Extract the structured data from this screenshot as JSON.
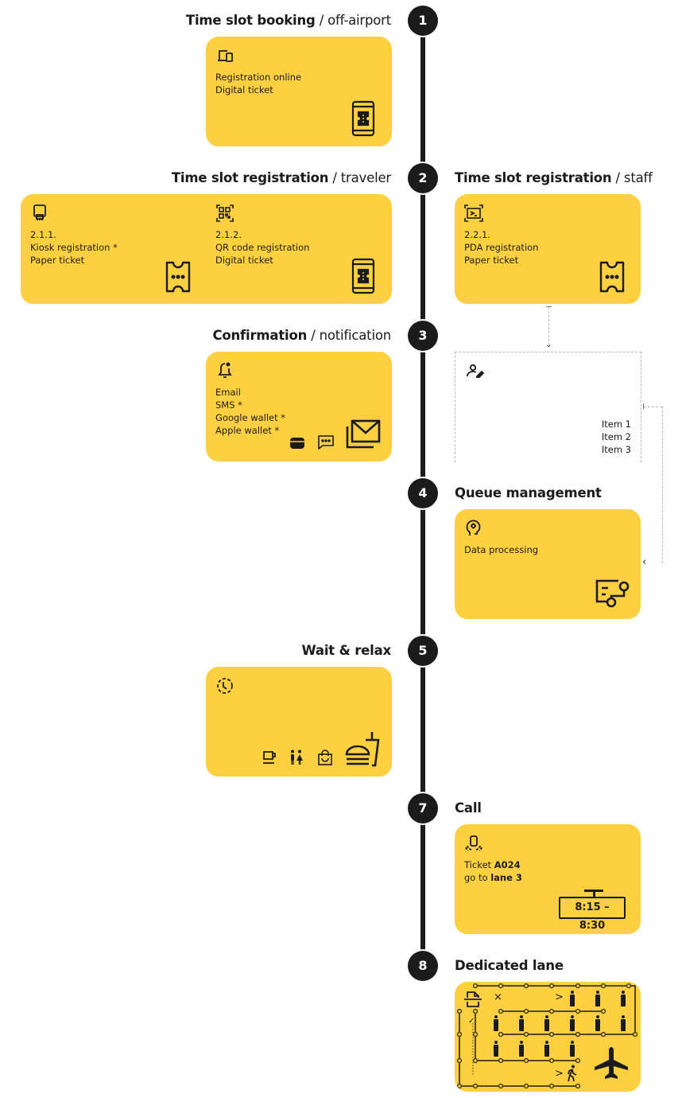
{
  "colors": {
    "card": "#fdd042",
    "ink": "#1b1b1b",
    "rail": "#1b1b1b",
    "dashed": "#b8b8b8"
  },
  "steps": [
    {
      "number": "1",
      "title": "Time slot booking",
      "subtitle": " / off-airport",
      "card": {
        "lines": [
          "Registration online",
          "Digital ticket"
        ],
        "icon": "devices-icon",
        "illustration": "mobile-ticket-icon"
      }
    },
    {
      "number": "2",
      "traveler": {
        "title": "Time slot registration",
        "subtitle": " / traveler",
        "options": [
          {
            "code": "2.1.1.",
            "lines": [
              "Kiosk registration *",
              "Paper ticket"
            ],
            "icon": "kiosk-icon",
            "illustration": "paper-ticket-icon"
          },
          {
            "code": "2.1.2.",
            "lines": [
              "QR code registration",
              "Digital ticket"
            ],
            "icon": "qr-scan-icon",
            "illustration": "mobile-ticket-icon"
          }
        ]
      },
      "staff": {
        "title": "Time slot registration",
        "subtitle": " / staff",
        "options": [
          {
            "code": "2.2.1.",
            "lines": [
              "PDA registration",
              "Paper ticket"
            ],
            "icon": "boarding-scan-icon",
            "illustration": "paper-ticket-icon"
          }
        ]
      }
    },
    {
      "number": "3",
      "title": "Confirmation",
      "subtitle": " / notification",
      "card": {
        "lines": [
          "Email",
          "SMS *",
          "Google wallet *",
          "Apple wallet *"
        ],
        "icon": "notification-bell-icon",
        "illustrations": [
          "wallet-icon",
          "sms-chat-icon",
          "email-icon"
        ]
      },
      "staff_panel": {
        "icon": "user-edit-icon",
        "items": [
          "Item 1",
          "Item 2",
          "Item 3"
        ]
      }
    },
    {
      "number": "4",
      "title": "Queue management",
      "card": {
        "lines": [
          "Data processing"
        ],
        "icon": "ai-head-icon",
        "illustration": "data-flow-icon"
      }
    },
    {
      "number": "5",
      "title": "Wait & relax",
      "card": {
        "icon": "clock-icon",
        "illustrations": [
          "coffee-icon",
          "restroom-icon",
          "shopping-bag-icon",
          "fast-food-icon"
        ]
      }
    },
    {
      "number": "7",
      "title": "Call",
      "card": {
        "icon": "pager-icon",
        "ticket_label": "Ticket ",
        "ticket_code": "A024",
        "go_label": "go to ",
        "lane": "lane 3",
        "time_window": "8:15 – 8:30"
      }
    },
    {
      "number": "8",
      "title": "Dedicated lane",
      "card": {
        "icon": "document-scan-icon",
        "reject_mark": "×",
        "accept_mark": "✓",
        "arrow": ">"
      }
    }
  ]
}
